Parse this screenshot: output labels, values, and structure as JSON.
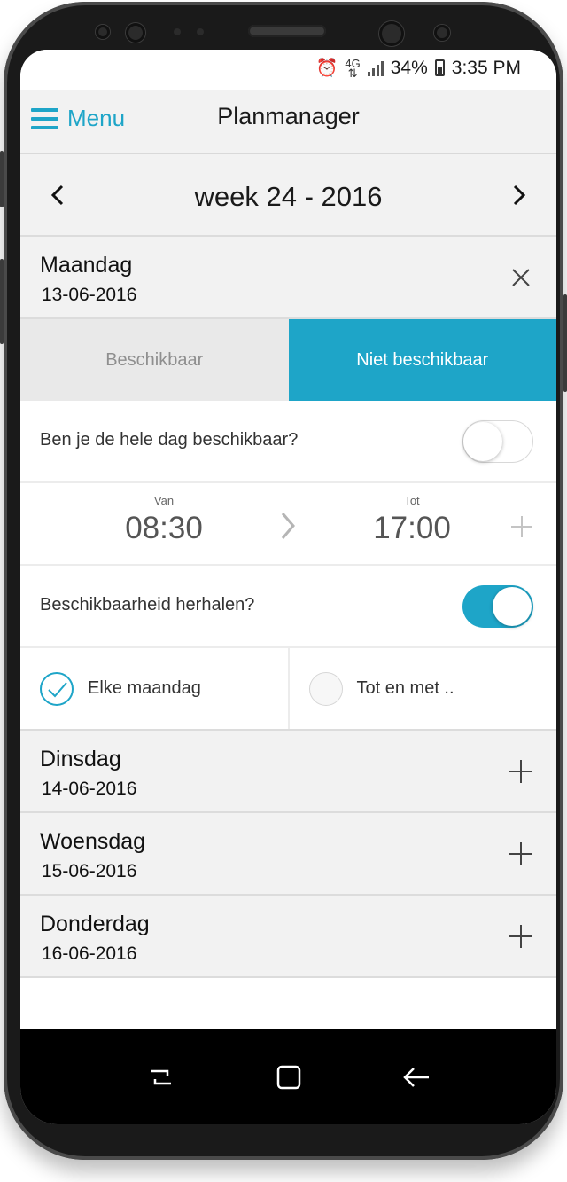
{
  "status_bar": {
    "battery_percent": "34%",
    "time": "3:35 PM",
    "icons": [
      "alarm-icon",
      "data-arrows-icon",
      "signal-icon",
      "battery-icon"
    ]
  },
  "header": {
    "menu_label": "Menu",
    "title": "Planmanager"
  },
  "week": {
    "title": "week 24 - 2016"
  },
  "expanded_day": {
    "name": "Maandag",
    "date": "13-06-2016",
    "segments": {
      "available": "Beschikbaar",
      "unavailable": "Niet beschikbaar",
      "selected": "unavailable"
    },
    "whole_day_question": "Ben je de hele dag beschikbaar?",
    "whole_day_enabled": false,
    "time": {
      "from_caption": "Van",
      "from_value": "08:30",
      "to_caption": "Tot",
      "to_value": "17:00"
    },
    "repeat_question": "Beschikbaarheid herhalen?",
    "repeat_enabled": true,
    "repeat_options": {
      "every_label": "Elke maandag",
      "until_label": "Tot en met ..",
      "selected": "every"
    }
  },
  "days": [
    {
      "name": "Dinsdag",
      "date": "14-06-2016"
    },
    {
      "name": "Woensdag",
      "date": "15-06-2016"
    },
    {
      "name": "Donderdag",
      "date": "16-06-2016"
    }
  ],
  "colors": {
    "accent": "#1ea5c8",
    "header_bg": "#f2f2f2",
    "segment_off_bg": "#e9e9e9"
  }
}
